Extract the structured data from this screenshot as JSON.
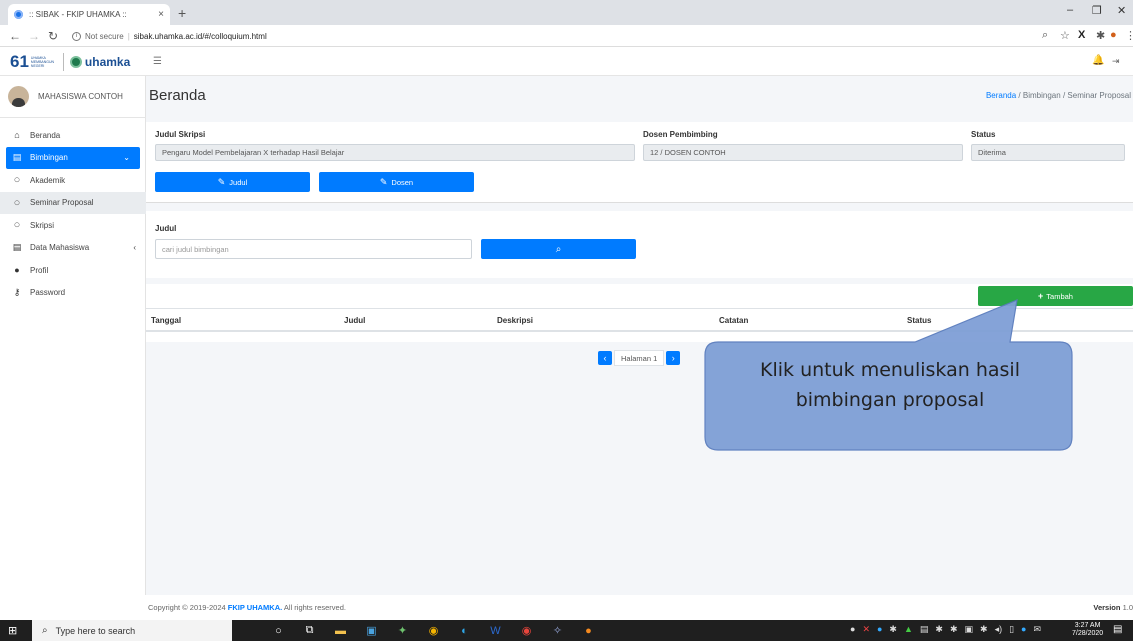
{
  "browser": {
    "tab_title": ":: SIBAK - FKIP UHAMKA ::",
    "tab_close": "×",
    "new_tab": "+",
    "security": "Not secure",
    "url": "sibak.uhamka.ac.id/#/colloquium.html",
    "min": "–",
    "max": "❐",
    "close": "✕"
  },
  "logo": {
    "num": "61",
    "sub": "UHAMKA MEMBANGUN NEGERI",
    "brand": "uhamka"
  },
  "user": {
    "name": "MAHASISWA CONTOH"
  },
  "menu": [
    {
      "label": "Beranda",
      "icon": "home-icon"
    },
    {
      "label": "Bimbingan",
      "icon": "book-icon"
    },
    {
      "label": "Akademik",
      "icon": "circle-icon"
    },
    {
      "label": "Seminar Proposal",
      "icon": "circle-icon"
    },
    {
      "label": "Skripsi",
      "icon": "circle-icon"
    },
    {
      "label": "Data Mahasiswa",
      "icon": "book-icon"
    },
    {
      "label": "Profil",
      "icon": "user-icon"
    },
    {
      "label": "Password",
      "icon": "key-icon"
    }
  ],
  "page": {
    "title": "Beranda",
    "breadcrumb": {
      "home": "Beranda",
      "sep1": "/",
      "mid": "Bimbingan",
      "sep2": "/",
      "current": "Seminar Proposal"
    }
  },
  "skripsi": {
    "judul_label": "Judul Skripsi",
    "judul_value": "Pengaru Model Pembelajaran X terhadap Hasil Belajar",
    "dosen_label": "Dosen Pembimbing",
    "dosen_value": "12 / DOSEN CONTOH",
    "status_label": "Status",
    "status_value": "Diterima",
    "btn_judul": "Judul",
    "btn_dosen": "Dosen"
  },
  "search": {
    "label": "Judul",
    "placeholder": "cari judul bimbingan"
  },
  "table": {
    "add_button": "Tambah",
    "columns": [
      "Tanggal",
      "Judul",
      "Deskripsi",
      "Catatan",
      "Status"
    ]
  },
  "pager": {
    "label": "Halaman 1"
  },
  "footer": {
    "copy_prefix": "Copyright © 2019-2024 ",
    "copy_brand": "FKIP UHAMKA.",
    "copy_suffix": " All rights reserved.",
    "version_label": "Version",
    "version_value": "1.0"
  },
  "callout": {
    "line1": "Klik untuk menuliskan hasil",
    "line2": "bimbingan proposal",
    "fill": "#7f9fd6"
  },
  "taskbar": {
    "search_placeholder": "Type here to search",
    "time": "3:27 AM",
    "date": "7/28/2020"
  }
}
